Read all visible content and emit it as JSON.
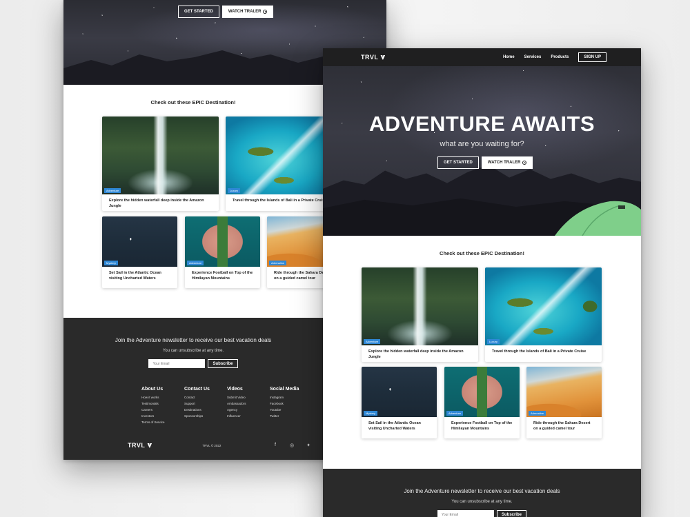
{
  "nav": {
    "brand": "TRVL",
    "links": [
      "Home",
      "Services",
      "Products"
    ],
    "signup": "SIGN UP"
  },
  "hero": {
    "title": "ADVENTURE AWAITS",
    "subtitle": "what are you waiting for?",
    "get_started": "GET STARTED",
    "watch_trailer": "WATCH TRALER"
  },
  "destinations": {
    "title": "Check out these EPIC Destination!",
    "cards": [
      {
        "tag": "Adventure",
        "text": "Explore the hidden waterfall deep inside the Amazon Jungle",
        "image_icon": "waterfall-image"
      },
      {
        "tag": "Luxury",
        "text": "Travel through the Islands of Bali in a Private Cruise",
        "image_icon": "island-image"
      },
      {
        "tag": "Mystery",
        "text": "Set Sail in the Atlantic Ocean visiting Uncharted Waters",
        "image_icon": "ocean-image"
      },
      {
        "tag": "Adventure",
        "text": "Experience Football on Top of the Himilayan Mountains",
        "image_icon": "football-island-image"
      },
      {
        "tag": "Adrenaline",
        "text": "Ride through the Sahara Desert on a guided camel tour",
        "image_icon": "desert-image"
      }
    ]
  },
  "newsletter": {
    "title": "Join the Adventure newsletter to receive our best vacation deals",
    "subtitle": "You can unsubscribe at any time.",
    "email_placeholder": "Your Email",
    "subscribe": "Subscribe"
  },
  "footer": {
    "columns": [
      {
        "title": "About Us",
        "items": [
          "How it works",
          "Testimonials",
          "Careers",
          "Investors",
          "Terms of Service"
        ]
      },
      {
        "title": "Contact Us",
        "items": [
          "Contact",
          "Support",
          "Destinations",
          "Sponsorships"
        ]
      },
      {
        "title": "Videos",
        "items": [
          "Submit Video",
          "Ambassadors",
          "Agency",
          "Influencer"
        ]
      },
      {
        "title": "Social Media",
        "items": [
          "Instagram",
          "Facebook",
          "Youtube",
          "Twitter"
        ]
      }
    ],
    "brand": "TRVL",
    "copyright": "TRVL © 2022",
    "social_icons": [
      "facebook-icon",
      "instagram-icon",
      "twitter-icon",
      "linkedin-icon"
    ]
  },
  "colors": {
    "tag_blue": "#2f88d6",
    "nav_bg": "#1f1f20",
    "footer_bg": "#2a2a2a",
    "tent_green": "#7fcf8a"
  }
}
